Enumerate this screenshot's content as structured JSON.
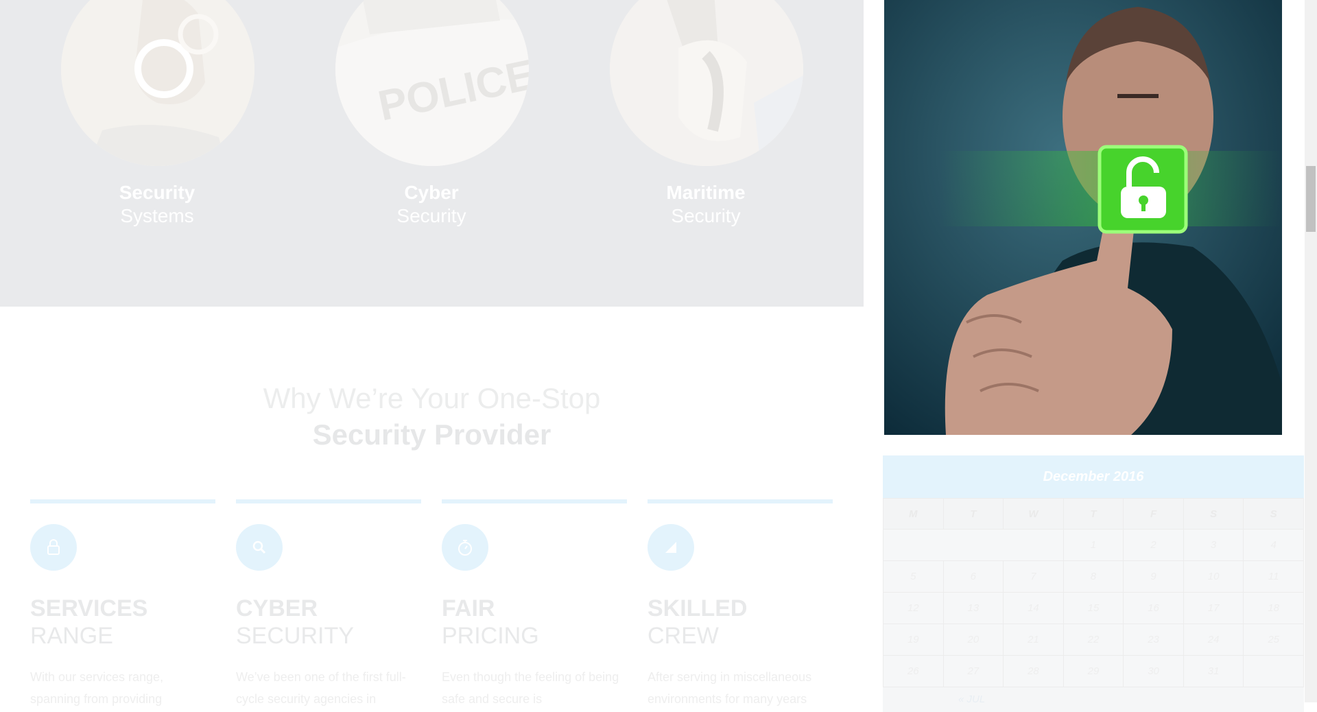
{
  "services": [
    {
      "bold": "Security",
      "light": "Systems",
      "icon": "handcuffs-photo"
    },
    {
      "bold": "Cyber",
      "light": "Security",
      "icon": "police-car-photo"
    },
    {
      "bold": "Maritime",
      "light": "Security",
      "icon": "radio-photo"
    }
  ],
  "police_text": "POLICE",
  "why": {
    "line1": "Why We’re Your One-Stop",
    "line2": "Security Provider"
  },
  "features": [
    {
      "title1": "SERVICES",
      "title2": "RANGE",
      "text": "With our services range, spanning from providing",
      "icon": "lock-icon"
    },
    {
      "title1": "CYBER",
      "title2": "SECURITY",
      "text": "We’ve been one of the first full-cycle security agencies in",
      "icon": "search-icon"
    },
    {
      "title1": "FAIR",
      "title2": "PRICING",
      "text": "Even though the feeling of being safe and secure is",
      "icon": "stopwatch-icon"
    },
    {
      "title1": "SKILLED",
      "title2": "CREW",
      "text": "After serving in miscellaneous environments for many years",
      "icon": "triangle-icon"
    }
  ],
  "calendar": {
    "caption": "December 2016",
    "days": [
      "M",
      "T",
      "W",
      "T",
      "F",
      "S",
      "S"
    ],
    "weeks": [
      [
        "",
        "",
        "",
        "1",
        "2",
        "3",
        "4"
      ],
      [
        "5",
        "6",
        "7",
        "8",
        "9",
        "10",
        "11"
      ],
      [
        "12",
        "13",
        "14",
        "15",
        "16",
        "17",
        "18"
      ],
      [
        "19",
        "20",
        "21",
        "22",
        "23",
        "24",
        "25"
      ],
      [
        "26",
        "27",
        "28",
        "29",
        "30",
        "31",
        ""
      ]
    ],
    "prev": "« JUL"
  }
}
